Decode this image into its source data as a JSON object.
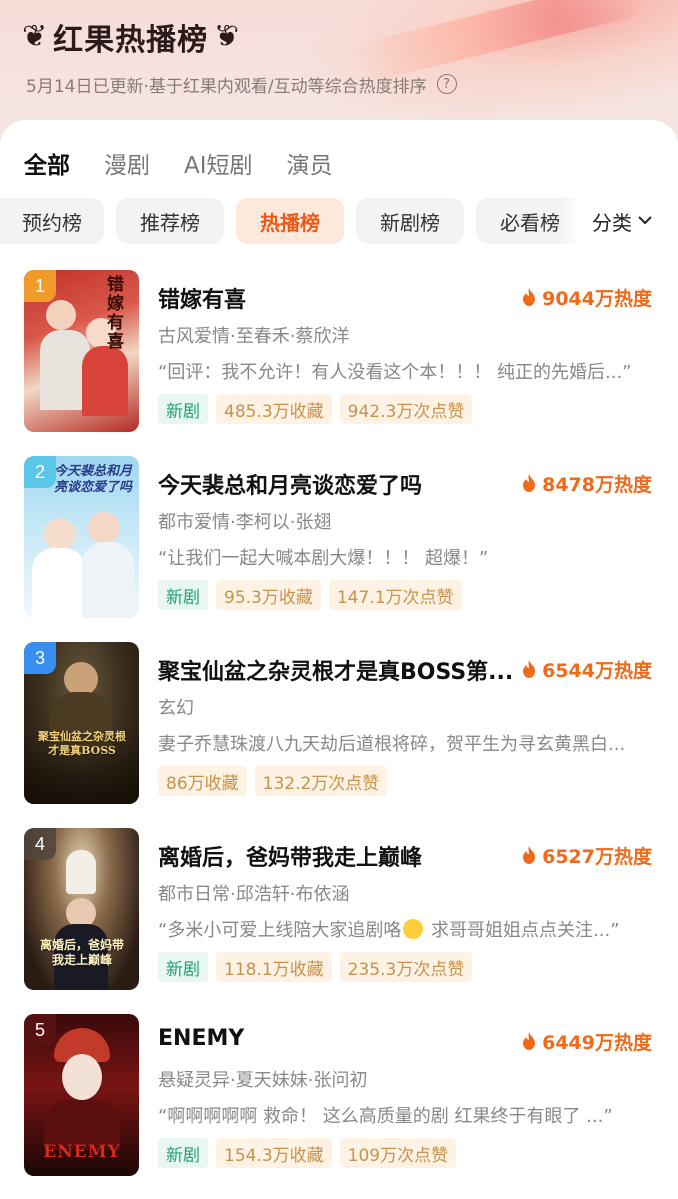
{
  "header": {
    "title": "红果热播榜",
    "subtitle": "5月14日已更新·基于红果内观看/互动等综合热度排序",
    "help_icon": "question-circle-icon"
  },
  "top_tabs": [
    {
      "label": "全部",
      "active": true
    },
    {
      "label": "漫剧",
      "active": false
    },
    {
      "label": "AI短剧",
      "active": false
    },
    {
      "label": "演员",
      "active": false
    }
  ],
  "chips": [
    {
      "label": "预约榜",
      "active": false
    },
    {
      "label": "推荐榜",
      "active": false
    },
    {
      "label": "热播榜",
      "active": true
    },
    {
      "label": "新剧榜",
      "active": false
    },
    {
      "label": "必看榜",
      "active": false
    }
  ],
  "filter": {
    "label": "分类",
    "icon": "chevron-down-icon"
  },
  "accent_color": "#f06a1a",
  "items": [
    {
      "rank": "1",
      "title": "错嫁有喜",
      "heat": "9044万热度",
      "meta": "古风爱情·至春禾·蔡欣洋",
      "quote": "“回评：我不允许！有人没看这个本！！！ 纯正的先婚后...”",
      "is_new": true,
      "new_label": "新剧",
      "collect": "485.3万收藏",
      "likes": "942.3万次点赞",
      "poster_text": "错嫁有喜"
    },
    {
      "rank": "2",
      "title": "今天裴总和月亮谈恋爱了吗",
      "heat": "8478万热度",
      "meta": "都市爱情·李柯以·张翅",
      "quote": "“让我们一起大喊本剧大爆！！！ 超爆！”",
      "is_new": true,
      "new_label": "新剧",
      "collect": "95.3万收藏",
      "likes": "147.1万次点赞",
      "poster_text": "今天裴总和月亮谈恋爱了吗"
    },
    {
      "rank": "3",
      "title": "聚宝仙盆之杂灵根才是真BOSS第...",
      "heat": "6544万热度",
      "meta": "玄幻",
      "quote": "妻子乔慧珠渡八九天劫后道根将碎，贺平生为寻玄黄黑白...",
      "is_new": false,
      "new_label": "",
      "collect": "86万收藏",
      "likes": "132.2万次点赞",
      "poster_text": "聚宝仙盆之杂灵根才是真BOSS"
    },
    {
      "rank": "4",
      "title": "离婚后，爸妈带我走上巅峰",
      "heat": "6527万热度",
      "meta": "都市日常·邱浩轩·布依涵",
      "quote_before": "“多米小可爱上线陪大家追剧咯",
      "quote_after": " 求哥哥姐姐点点关注...”",
      "is_new": true,
      "new_label": "新剧",
      "collect": "118.1万收藏",
      "likes": "235.3万次点赞",
      "poster_text": "离婚后，爸妈带我走上巅峰"
    },
    {
      "rank": "5",
      "title": "ENEMY",
      "heat": "6449万热度",
      "meta": "悬疑灵异·夏天妹妹·张问初",
      "quote": "“啊啊啊啊啊 救命！ 这么高质量的剧 红果终于有眼了 ...”",
      "is_new": true,
      "new_label": "新剧",
      "collect": "154.3万收藏",
      "likes": "109万次点赞",
      "poster_text": "ENEMY"
    }
  ]
}
